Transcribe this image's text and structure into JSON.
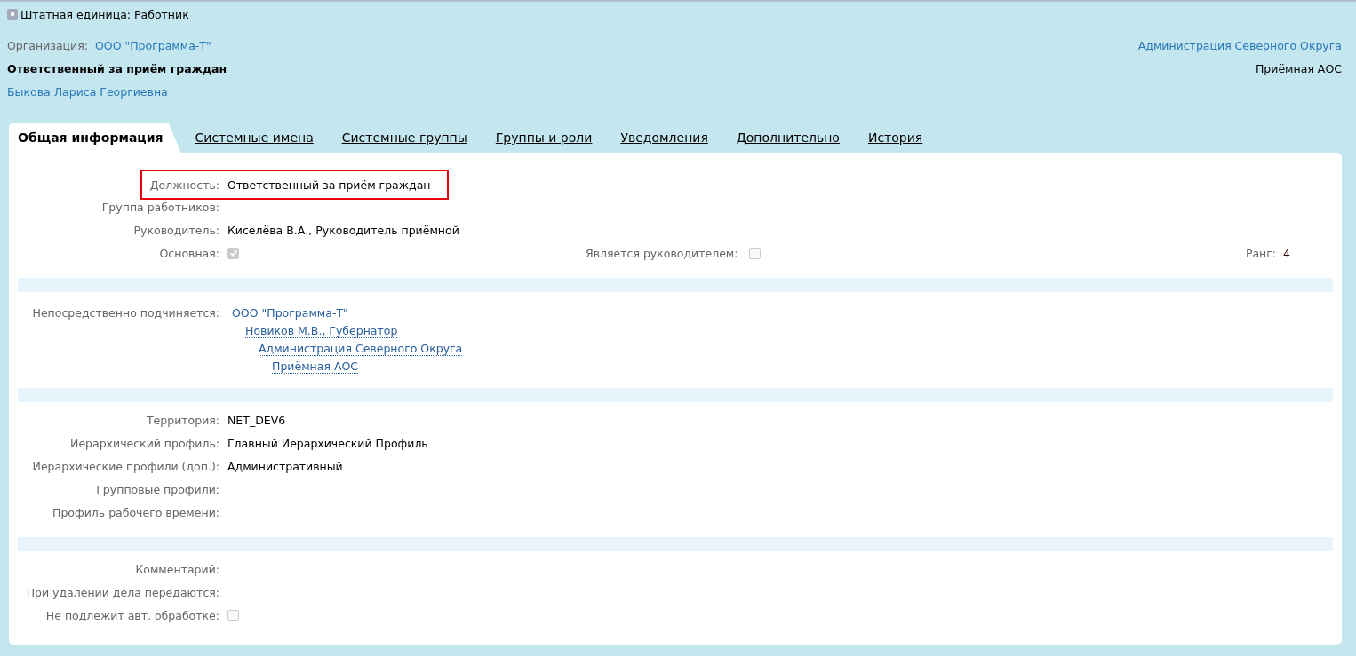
{
  "header": {
    "title": "Штатная единица: Работник",
    "organization_label": "Организация:",
    "organization": "ООО \"Программа-Т\"",
    "position": "Ответственный за приём граждан",
    "person": "Быкова Лариса Георгиевна",
    "department": "Администрация Северного Округа",
    "unit": "Приёмная АОС"
  },
  "tabs": [
    {
      "label": "Общая информация",
      "selected": true
    },
    {
      "label": "Системные имена",
      "selected": false
    },
    {
      "label": "Системные группы",
      "selected": false
    },
    {
      "label": "Группы и роли",
      "selected": false
    },
    {
      "label": "Уведомления",
      "selected": false
    },
    {
      "label": "Дополнительно",
      "selected": false
    },
    {
      "label": "История",
      "selected": false
    }
  ],
  "sections": [
    {
      "rows": [
        {
          "kind": "text",
          "label": "Должность:",
          "value": "Ответственный за приём граждан",
          "highlighted": true
        },
        {
          "kind": "text",
          "label": "Группа работников:",
          "highlighted": false
        },
        {
          "kind": "text",
          "label": "Руководитель:",
          "value": "Киселёва В.А., Руководитель приёмной",
          "highlighted": false
        },
        {
          "kind": "flags",
          "label": "Основная:",
          "checked": true,
          "manager_label": "Является руководителем:",
          "manager_checked": false,
          "rank_label": "Ранг:",
          "rank": "4"
        }
      ]
    },
    {
      "rows": [
        {
          "kind": "tree",
          "label": "Непосредственно подчиняется:",
          "tree": [
            {
              "label": "ООО \"Программа-Т\"",
              "children": [
                {
                  "label": "Новиков М.В., Губернатор",
                  "children": [
                    {
                      "label": "Администрация Северного Округа",
                      "children": [
                        {
                          "label": "Приёмная АОС"
                        }
                      ]
                    }
                  ]
                }
              ]
            }
          ]
        }
      ]
    },
    {
      "rows": [
        {
          "kind": "text",
          "label": "Территория:",
          "value": "NET_DEV6",
          "highlighted": false
        },
        {
          "kind": "text",
          "label": "Иерархический профиль:",
          "value": "Главный Иерархический Профиль",
          "highlighted": false
        },
        {
          "kind": "text",
          "label": "Иерархические профили (доп.):",
          "value": "Административный",
          "highlighted": false
        },
        {
          "kind": "text",
          "label": "Групповые профили:",
          "highlighted": false
        },
        {
          "kind": "text",
          "label": "Профиль рабочего времени:",
          "highlighted": false
        }
      ]
    },
    {
      "rows": [
        {
          "kind": "text",
          "label": "Комментарий:",
          "highlighted": false
        },
        {
          "kind": "text",
          "label": "При удалении дела передаются:",
          "highlighted": false
        },
        {
          "kind": "checkbox",
          "label": "Не подлежит авт. обработке:",
          "checked": false
        }
      ]
    }
  ]
}
